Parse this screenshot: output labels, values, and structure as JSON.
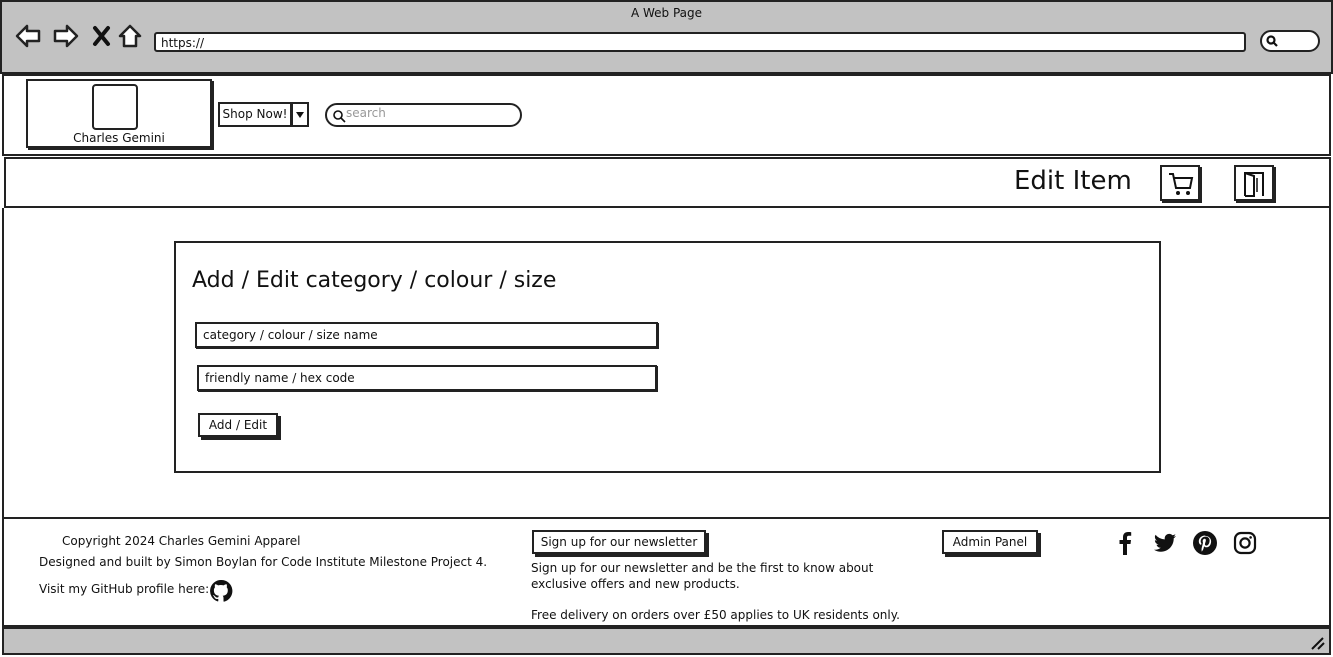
{
  "browser": {
    "window_title": "A Web Page",
    "url": "https://",
    "icons": [
      "back-arrow-icon",
      "forward-arrow-icon",
      "close-x-icon",
      "home-icon",
      "search-icon"
    ]
  },
  "header": {
    "logo_text": "Charles Gemini",
    "shop_button_label": "Shop Now!",
    "search_placeholder": "search"
  },
  "title_bar": {
    "title": "Edit Item",
    "icons": [
      "cart-icon",
      "door-exit-icon"
    ]
  },
  "form": {
    "heading": "Add / Edit category / colour / size",
    "field1_value": "category / colour / size name",
    "field2_value": "friendly name / hex code",
    "submit_label": "Add / Edit"
  },
  "footer": {
    "copyright": "Copyright 2024 Charles Gemini Apparel",
    "designed_by": "Designed and built by Simon Boylan for Code Institute Milestone Project 4.",
    "github_text": "Visit my GitHub profile here:",
    "newsletter_button": "Sign up for our newsletter",
    "newsletter_line1": "Sign up for our newsletter and be the first to know about",
    "newsletter_line2": "exclusive offers and new products.",
    "delivery_note": "Free delivery on orders over £50 applies to UK residents only.",
    "admin_button": "Admin Panel",
    "social_icons": [
      "facebook-icon",
      "twitter-icon",
      "pinterest-icon",
      "instagram-icon"
    ]
  }
}
